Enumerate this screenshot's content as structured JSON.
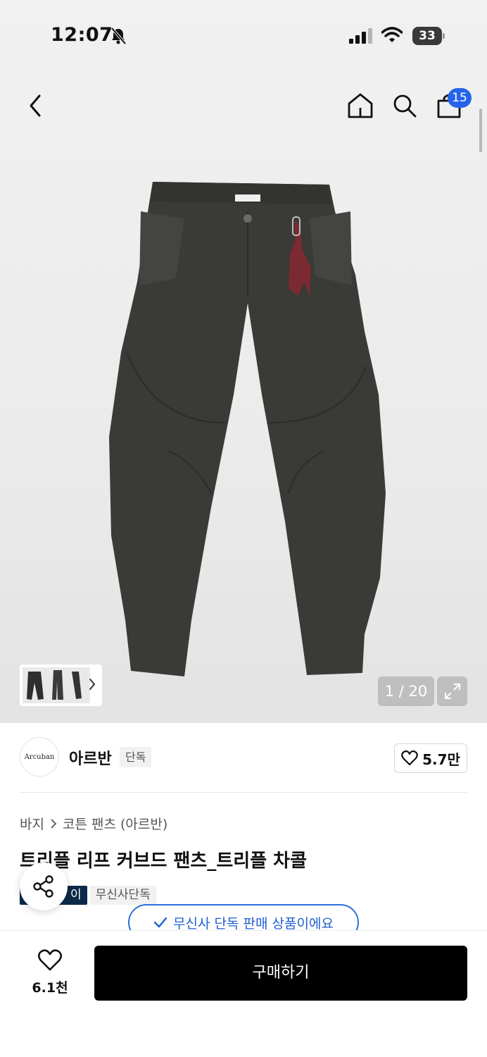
{
  "status_bar": {
    "time": "12:07",
    "battery": "33"
  },
  "nav": {
    "cart_count": "15"
  },
  "gallery": {
    "counter": "1 / 20"
  },
  "brand": {
    "logo_text": "Arcuban",
    "name": "아르반",
    "exclusive_tag": "단독",
    "likes": "5.7만"
  },
  "breadcrumb": {
    "category": "바지",
    "subcategory": "코튼 팬츠 (아르반)"
  },
  "product": {
    "title": "트리플 리프 커브드 팬츠_트리플 차콜",
    "tags": [
      "이",
      "무신사단독"
    ],
    "exclusive_notice": "무신사 단독 판매 상품이에요"
  },
  "bottom": {
    "wish_count": "6.1천",
    "buy_label": "구매하기"
  },
  "colors": {
    "accent_blue": "#2563eb",
    "buy_button": "#000000",
    "tag_navy": "#0b2a4a"
  }
}
